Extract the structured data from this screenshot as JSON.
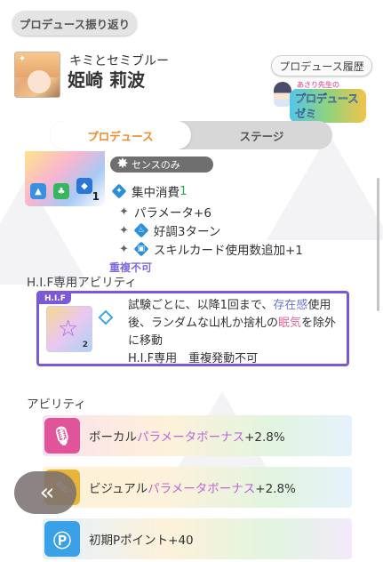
{
  "header": {
    "back_review_label": "プロデュース振り返り",
    "subtitle": "キミとセミブルー",
    "name": "姫崎 莉波",
    "history_label": "プロデュース履歴",
    "logo_top": "あさり先生の",
    "logo_main": "プロデュースゼミ"
  },
  "tabs": [
    {
      "label": "プロデュース",
      "active": true
    },
    {
      "label": "ステージ",
      "active": false
    }
  ],
  "card": {
    "level": "1",
    "sense_label": "センスのみ",
    "effects": [
      {
        "icon": "focus-icon",
        "label": "集中消費",
        "value": "1"
      },
      {
        "prefix": "+",
        "label": "パラメータ+6"
      },
      {
        "prefix": "+",
        "icon": "good-condition-icon",
        "label": "好調3ターン"
      },
      {
        "prefix": "+",
        "icon": "skill-card-icon",
        "label": "スキルカード使用数追加+1"
      }
    ],
    "duplicate_note": "重複不可"
  },
  "hif": {
    "section_title": "H.I.F専用アビリティ",
    "tag": "H.I.F",
    "card_number": "2",
    "line1_pre": "試験ごとに、以降1回まで、",
    "line1_blue": "存在感",
    "line1_post": "使用",
    "line2_pre": "後、ランダムな山札か捨札の",
    "line2_pink": "眠気",
    "line2_post": "を除外",
    "line3": "に移動",
    "line4": "H.I.F専用　重複発動不可"
  },
  "abilities": {
    "section_title": "アビリティ",
    "items": [
      {
        "pre": "ボーカル",
        "grad": "パラメータボーナス",
        "post": "+2.8%",
        "icon": "vocal-mic-icon",
        "color": "#e0559a"
      },
      {
        "pre": "ビジュアル",
        "grad": "パラメータボーナス",
        "post": "+2.8%",
        "icon": "visual-icon",
        "color": "#e8b43a"
      },
      {
        "pre": "初期Pポイント+40",
        "grad": "",
        "post": "",
        "icon": "p-point-icon",
        "color": "#3aa0e8"
      }
    ]
  },
  "back_button_label": "‹‹"
}
